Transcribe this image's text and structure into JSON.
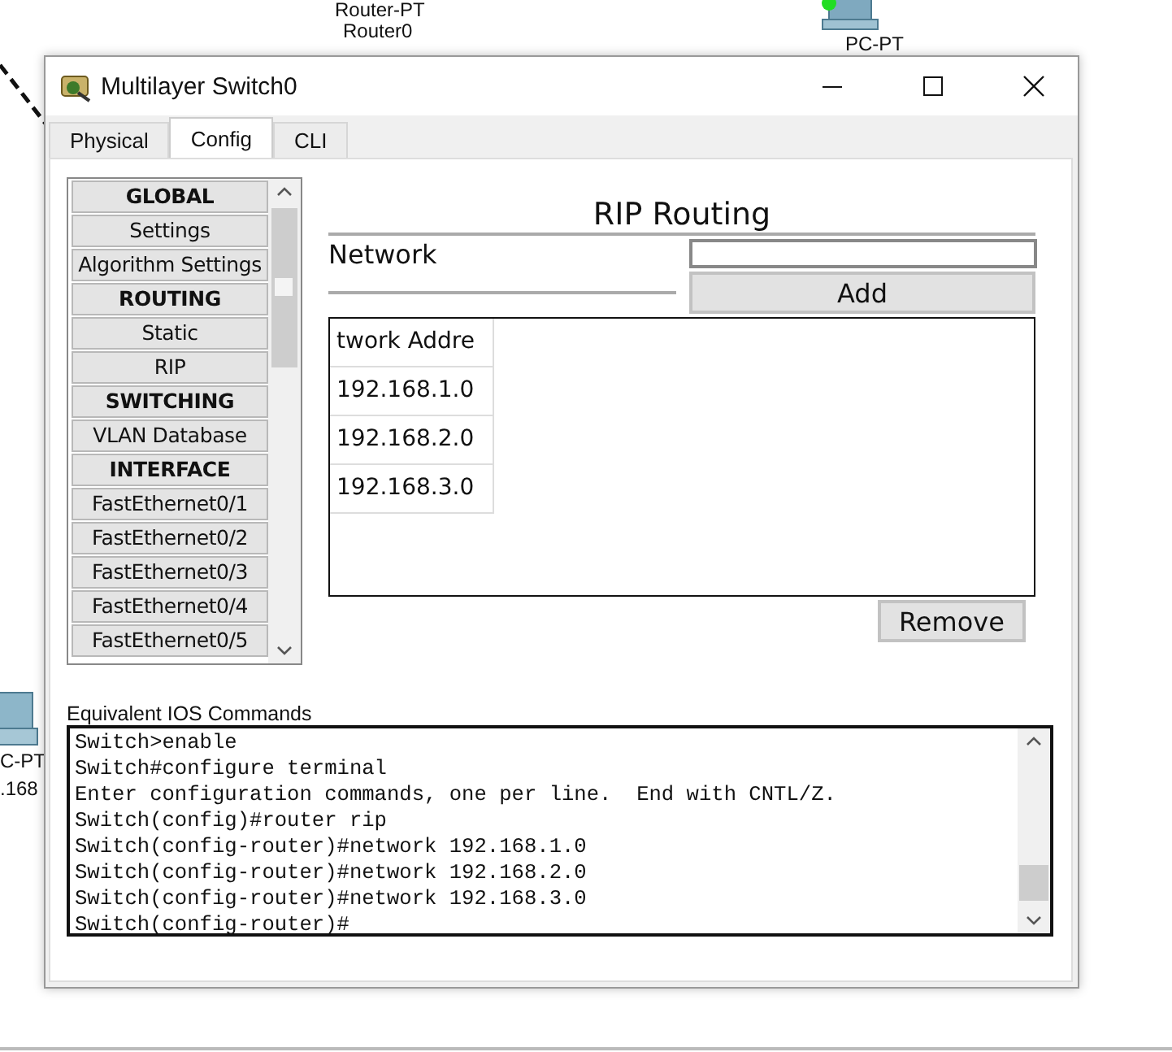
{
  "canvas": {
    "labels": [
      {
        "text": "Router-PT"
      },
      {
        "text": "Router0"
      },
      {
        "text": "PC-PT"
      },
      {
        "text": "C-PT"
      },
      {
        "text": ".168"
      }
    ]
  },
  "window": {
    "title": "Multilayer Switch0"
  },
  "tabs": [
    {
      "label": "Physical",
      "selected": false
    },
    {
      "label": "Config",
      "selected": true
    },
    {
      "label": "CLI",
      "selected": false
    }
  ],
  "sidebar": {
    "items": [
      {
        "kind": "header",
        "label": "GLOBAL"
      },
      {
        "kind": "item",
        "label": "Settings"
      },
      {
        "kind": "item",
        "label": "Algorithm Settings"
      },
      {
        "kind": "header",
        "label": "ROUTING"
      },
      {
        "kind": "item",
        "label": "Static"
      },
      {
        "kind": "item",
        "label": "RIP"
      },
      {
        "kind": "header",
        "label": "SWITCHING"
      },
      {
        "kind": "item",
        "label": "VLAN Database"
      },
      {
        "kind": "header",
        "label": "INTERFACE"
      },
      {
        "kind": "item",
        "label": "FastEthernet0/1"
      },
      {
        "kind": "item",
        "label": "FastEthernet0/2"
      },
      {
        "kind": "item",
        "label": "FastEthernet0/3"
      },
      {
        "kind": "item",
        "label": "FastEthernet0/4"
      },
      {
        "kind": "item",
        "label": "FastEthernet0/5"
      }
    ]
  },
  "rip": {
    "title": "RIP Routing",
    "network_label": "Network",
    "add_button": "Add",
    "table": {
      "columns": [
        "twork Addre"
      ],
      "rows": [
        [
          "192.168.1.0"
        ],
        [
          "192.168.2.0"
        ],
        [
          "192.168.3.0"
        ]
      ]
    },
    "remove_button": "Remove"
  },
  "ios": {
    "label": "Equivalent IOS Commands",
    "lines": [
      "Switch>enable",
      "Switch#configure terminal",
      "Enter configuration commands, one per line.  End with CNTL/Z.",
      "Switch(config)#router rip",
      "Switch(config-router)#network 192.168.1.0",
      "Switch(config-router)#network 192.168.2.0",
      "Switch(config-router)#network 192.168.3.0",
      "Switch(config-router)#"
    ]
  }
}
